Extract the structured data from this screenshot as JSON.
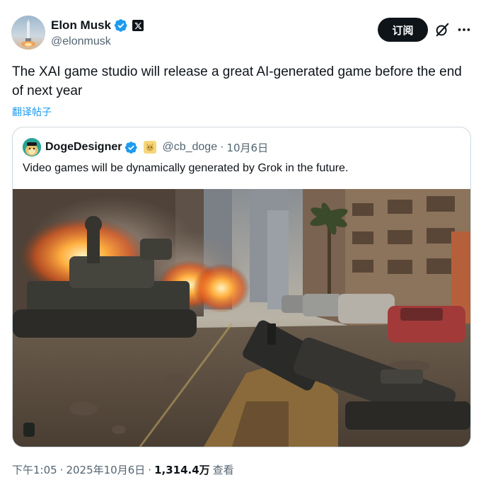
{
  "author": {
    "display_name": "Elon Musk",
    "handle": "@elonmusk",
    "verified_icon": "verified-badge-icon",
    "affiliation_icon": "x-logo-icon"
  },
  "actions": {
    "subscribe_label": "订阅",
    "grok_icon": "grok-icon",
    "more_icon": "more-icon"
  },
  "tweet": {
    "text": "The XAI game studio will release a great AI-generated game before the end of next year",
    "translate_label": "翻译帖子"
  },
  "quote": {
    "display_name": "DogeDesigner",
    "handle": "@cb_doge",
    "separator": "·",
    "date": "10月6日",
    "text": "Video games will be dynamically generated by Grok in the future.",
    "image_icon": "war-scene-image"
  },
  "footer": {
    "time": "下午1:05",
    "sep1": "·",
    "date": "2025年10月6日",
    "sep2": "·",
    "views_count": "1,314.4万",
    "views_label": "查看"
  },
  "colors": {
    "accent": "#1d9bf0",
    "text": "#0f1419",
    "muted": "#536471",
    "border": "#cfd9de"
  }
}
